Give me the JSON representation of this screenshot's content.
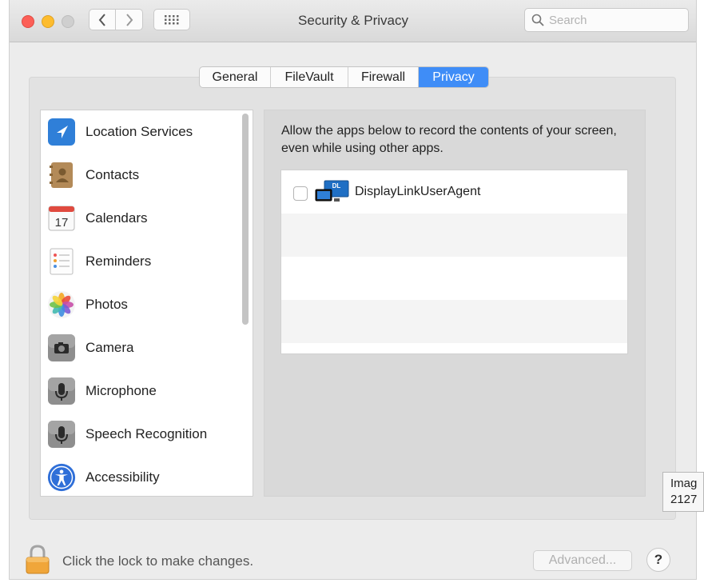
{
  "window": {
    "title": "Security & Privacy"
  },
  "search": {
    "placeholder": "Search"
  },
  "tabs": [
    {
      "label": "General"
    },
    {
      "label": "FileVault"
    },
    {
      "label": "Firewall"
    },
    {
      "label": "Privacy",
      "selected": true
    }
  ],
  "sidebar": {
    "items": [
      {
        "label": "Location Services",
        "icon": "location-arrow-icon"
      },
      {
        "label": "Contacts",
        "icon": "contacts-book-icon"
      },
      {
        "label": "Calendars",
        "icon": "calendar-icon",
        "icon_text": "17"
      },
      {
        "label": "Reminders",
        "icon": "reminders-list-icon"
      },
      {
        "label": "Photos",
        "icon": "photos-flower-icon"
      },
      {
        "label": "Camera",
        "icon": "camera-icon"
      },
      {
        "label": "Microphone",
        "icon": "microphone-icon"
      },
      {
        "label": "Speech Recognition",
        "icon": "speech-recognition-icon"
      },
      {
        "label": "Accessibility",
        "icon": "accessibility-icon"
      }
    ]
  },
  "main": {
    "description": "Allow the apps below to record the contents of your screen, even while using other apps.",
    "apps": [
      {
        "name": "DisplayLinkUserAgent",
        "checked": false,
        "icon": "displaylink-icon",
        "icon_text": "DL"
      }
    ]
  },
  "footer": {
    "lock_text": "Click the lock to make changes.",
    "advanced_label": "Advanced...",
    "help_label": "?"
  },
  "tooltip": {
    "lines": [
      "Imag",
      "2127"
    ]
  },
  "colors": {
    "accent": "#3f8df7",
    "close": "#fc5f57",
    "minimize": "#fdbc2e"
  }
}
